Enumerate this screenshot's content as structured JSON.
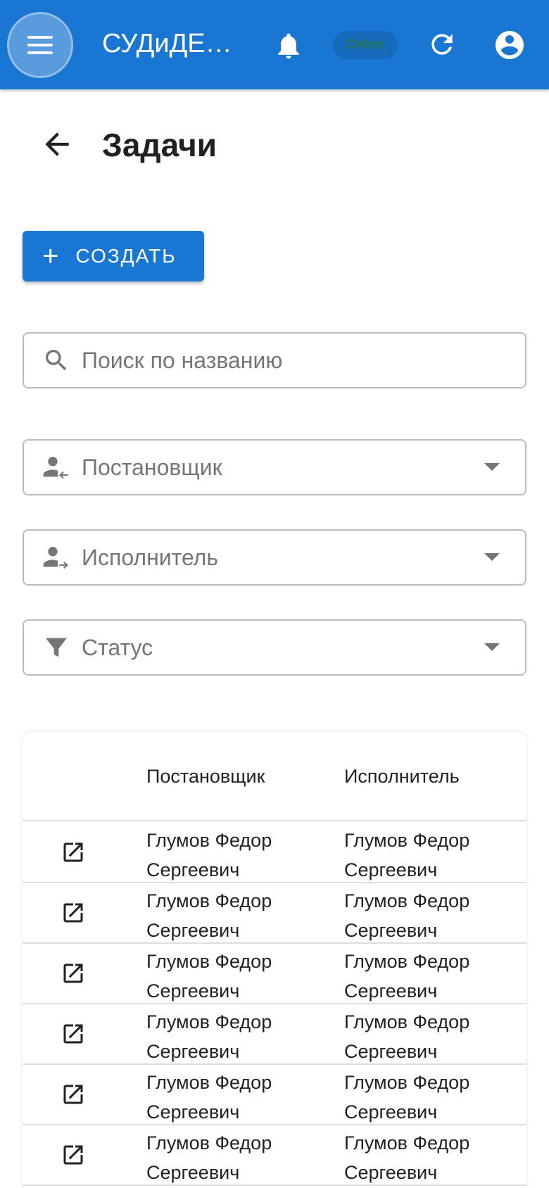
{
  "appbar": {
    "title": "СУДиДЕ…",
    "menu_icon": "menu-icon",
    "notification_icon": "bell-icon",
    "status": "Online",
    "refresh_icon": "refresh-icon",
    "account_icon": "account-circle-icon",
    "color": "#1976d2"
  },
  "page": {
    "back_icon": "arrow-left-icon",
    "title": "Задачи"
  },
  "create_button": {
    "label": "СОЗДАТЬ",
    "icon": "plus-icon"
  },
  "filters": {
    "search_placeholder": "Поиск по названию",
    "author": "Постановщик",
    "assignee": "Исполнитель",
    "status": "Статус"
  },
  "table": {
    "columns": [
      "",
      "Постановщик",
      "Исполнитель"
    ],
    "rows": [
      {
        "author_line1": "Глумов Федор",
        "author_line2": "Сергеевич",
        "assignee_line1": "Глумов Федор",
        "assignee_line2": "Сергеевич"
      },
      {
        "author_line1": "Глумов Федор",
        "author_line2": "Сергеевич",
        "assignee_line1": "Глумов Федор",
        "assignee_line2": "Сергеевич"
      },
      {
        "author_line1": "Глумов Федор",
        "author_line2": "Сергеевич",
        "assignee_line1": "Глумов Федор",
        "assignee_line2": "Сергеевич"
      },
      {
        "author_line1": "Глумов Федор",
        "author_line2": "Сергеевич",
        "assignee_line1": "Глумов Федор",
        "assignee_line2": "Сергеевич"
      },
      {
        "author_line1": "Глумов Федор",
        "author_line2": "Сергеевич",
        "assignee_line1": "Глумов Федор",
        "assignee_line2": "Сергеевич"
      },
      {
        "author_line1": "Глумов Федор",
        "author_line2": "Сергеевич",
        "assignee_line1": "Глумов Федор",
        "assignee_line2": "Сергеевич"
      }
    ]
  }
}
